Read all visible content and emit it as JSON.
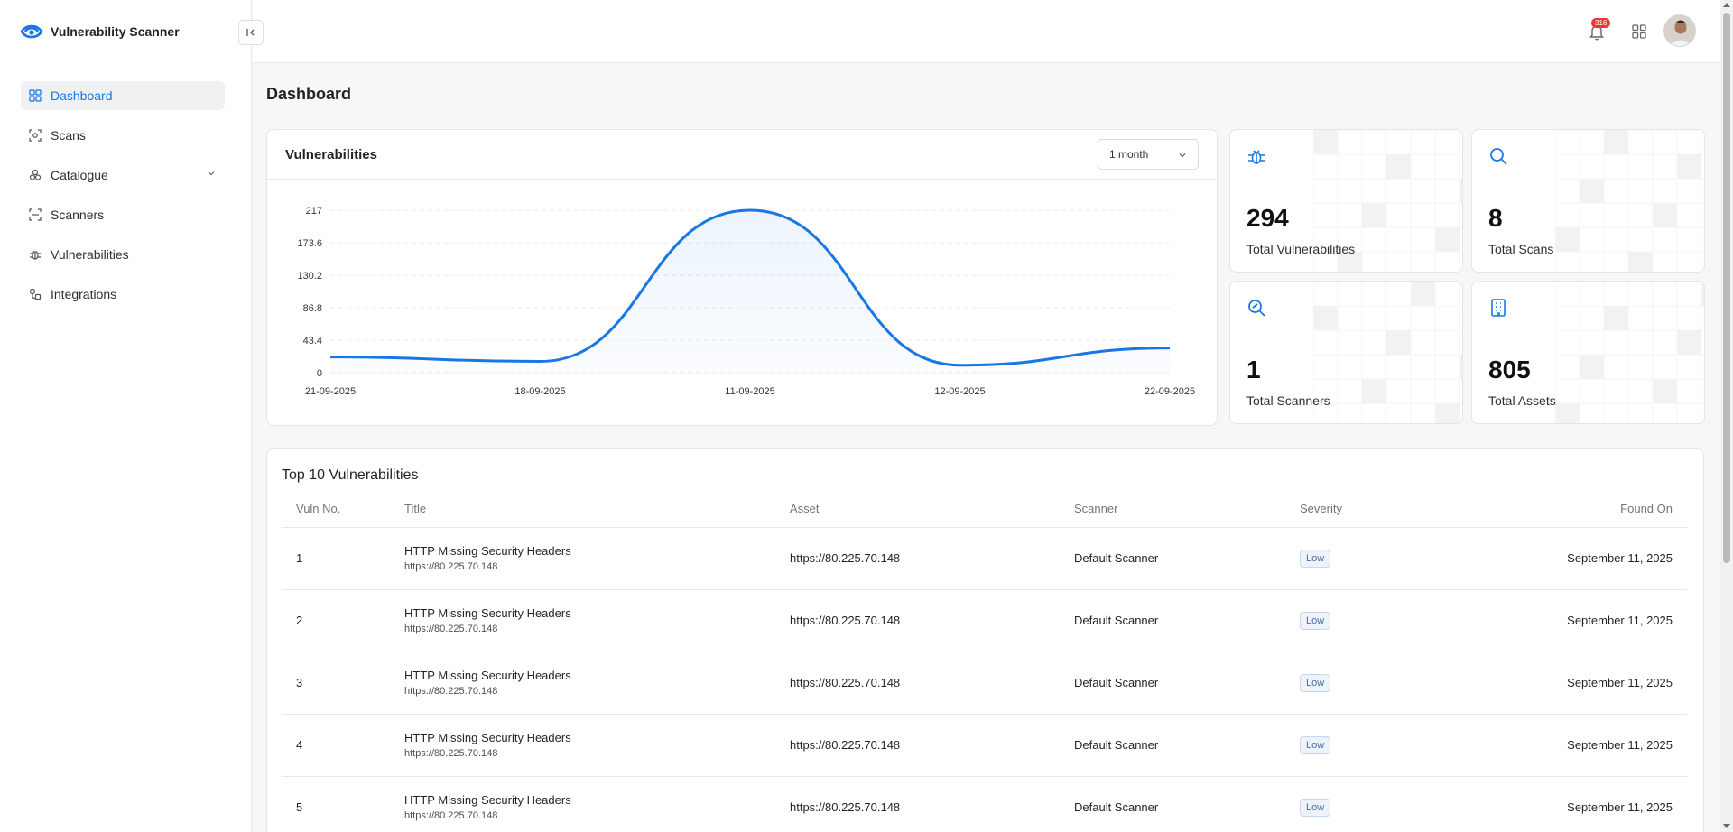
{
  "app": {
    "name": "Vulnerability Scanner"
  },
  "sidebar": {
    "items": [
      {
        "label": "Dashboard",
        "icon": "dashboard-icon",
        "active": true
      },
      {
        "label": "Scans",
        "icon": "scan-icon"
      },
      {
        "label": "Catalogue",
        "icon": "catalogue-icon",
        "expandable": true
      },
      {
        "label": "Scanners",
        "icon": "scanner-icon"
      },
      {
        "label": "Vulnerabilities",
        "icon": "bug-icon"
      },
      {
        "label": "Integrations",
        "icon": "integrations-icon"
      }
    ]
  },
  "topbar": {
    "notifications_count": "316",
    "icons": [
      "bell-icon",
      "apps-grid-icon",
      "avatar"
    ]
  },
  "page": {
    "title": "Dashboard"
  },
  "chart_card": {
    "title": "Vulnerabilities",
    "period": "1 month"
  },
  "chart_data": {
    "type": "line",
    "title": "Vulnerabilities",
    "x": [
      "21-09-2025",
      "18-09-2025",
      "11-09-2025",
      "12-09-2025",
      "22-09-2025"
    ],
    "y": [
      21,
      15,
      217,
      10,
      33
    ],
    "yticks": [
      "0",
      "43.4",
      "86.8",
      "130.2",
      "173.6",
      "217"
    ],
    "ylim": [
      0,
      217
    ],
    "grid": true,
    "color": "#1877e5"
  },
  "stats": [
    {
      "value": "294",
      "label": "Total Vulnerabilities",
      "icon": "bug-icon"
    },
    {
      "value": "8",
      "label": "Total Scans",
      "icon": "search-icon"
    },
    {
      "value": "1",
      "label": "Total Scanners",
      "icon": "scan-search-icon"
    },
    {
      "value": "805",
      "label": "Total Assets",
      "icon": "building-icon"
    }
  ],
  "top_vulns": {
    "title": "Top 10 Vulnerabilities",
    "columns": [
      "Vuln No.",
      "Title",
      "Asset",
      "Scanner",
      "Severity",
      "Found On"
    ],
    "rows": [
      {
        "no": "1",
        "title": "HTTP Missing Security Headers",
        "subtitle": "https://80.225.70.148",
        "asset": "https://80.225.70.148",
        "scanner": "Default Scanner",
        "severity": "Low",
        "found": "September 11, 2025"
      },
      {
        "no": "2",
        "title": "HTTP Missing Security Headers",
        "subtitle": "https://80.225.70.148",
        "asset": "https://80.225.70.148",
        "scanner": "Default Scanner",
        "severity": "Low",
        "found": "September 11, 2025"
      },
      {
        "no": "3",
        "title": "HTTP Missing Security Headers",
        "subtitle": "https://80.225.70.148",
        "asset": "https://80.225.70.148",
        "scanner": "Default Scanner",
        "severity": "Low",
        "found": "September 11, 2025"
      },
      {
        "no": "4",
        "title": "HTTP Missing Security Headers",
        "subtitle": "https://80.225.70.148",
        "asset": "https://80.225.70.148",
        "scanner": "Default Scanner",
        "severity": "Low",
        "found": "September 11, 2025"
      },
      {
        "no": "5",
        "title": "HTTP Missing Security Headers",
        "subtitle": "https://80.225.70.148",
        "asset": "https://80.225.70.148",
        "scanner": "Default Scanner",
        "severity": "Low",
        "found": "September 11, 2025"
      }
    ]
  }
}
